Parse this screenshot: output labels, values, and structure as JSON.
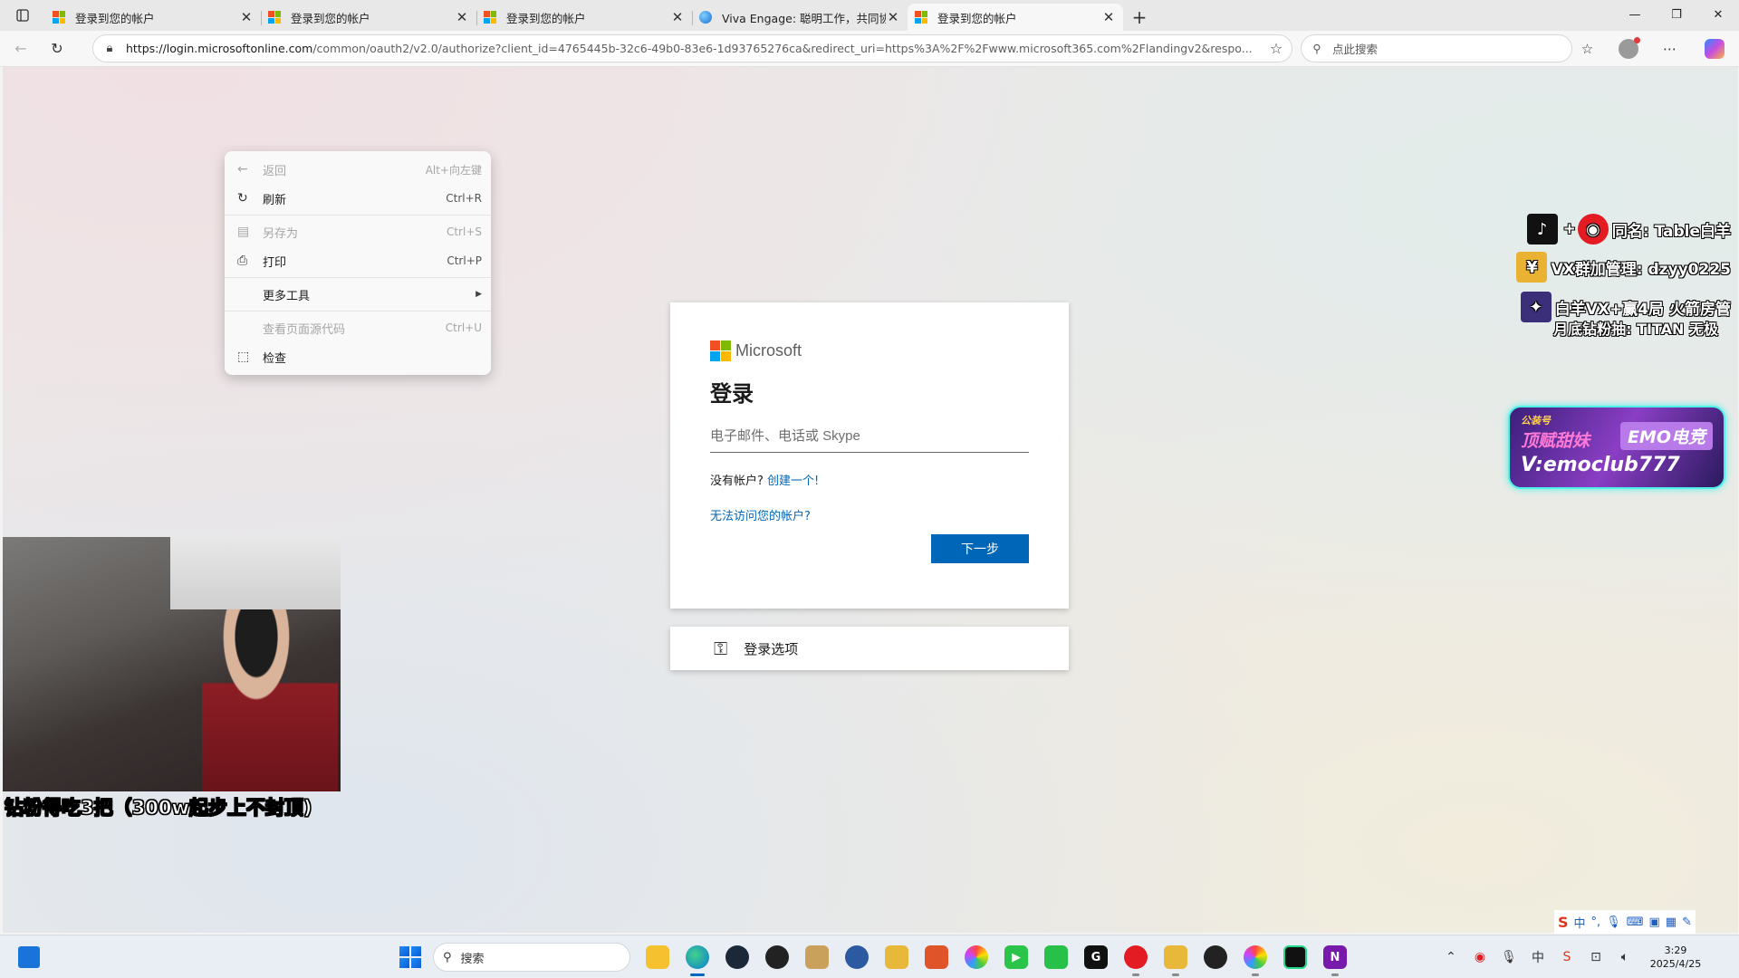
{
  "browser": {
    "tabs": [
      {
        "title": "登录到您的帐户",
        "favicon": "microsoft-icon",
        "active": false
      },
      {
        "title": "登录到您的帐户",
        "favicon": "microsoft-icon",
        "active": false
      },
      {
        "title": "登录到您的帐户",
        "favicon": "microsoft-icon",
        "active": false
      },
      {
        "title": "Viva Engage: 聪明工作，共同协作",
        "favicon": "viva-engage-icon",
        "active": false
      },
      {
        "title": "登录到您的帐户",
        "favicon": "microsoft-icon",
        "active": true
      }
    ],
    "url_host": "https://login.microsoftonline.com",
    "url_rest": "/common/oauth2/v2.0/authorize?client_id=4765445b-32c6-49b0-83e6-1d93765276ca&redirect_uri=https%3A%2F%2Fwww.microsoft365.com%2Flandingv2&respo...",
    "search_placeholder": "点此搜索"
  },
  "context_menu": {
    "items": [
      {
        "label": "返回",
        "shortcut": "Alt+向左键",
        "icon": "back-arrow-icon",
        "disabled": true
      },
      {
        "label": "刷新",
        "shortcut": "Ctrl+R",
        "icon": "refresh-icon",
        "disabled": false
      },
      {
        "label": "另存为",
        "shortcut": "Ctrl+S",
        "icon": "save-as-icon",
        "disabled": true
      },
      {
        "label": "打印",
        "shortcut": "Ctrl+P",
        "icon": "printer-icon",
        "disabled": false
      },
      {
        "label": "更多工具",
        "shortcut": "",
        "icon": "",
        "disabled": false
      },
      {
        "label": "查看页面源代码",
        "shortcut": "Ctrl+U",
        "icon": "",
        "disabled": true
      },
      {
        "label": "检查",
        "shortcut": "",
        "icon": "inspect-icon",
        "disabled": false
      }
    ]
  },
  "login": {
    "brand": "Microsoft",
    "heading": "登录",
    "email_placeholder": "电子邮件、电话或 Skype",
    "no_account_text": "没有帐户?",
    "create_link": "创建一个!",
    "cant_access_link": "无法访问您的帐户?",
    "next_button": "下一步",
    "options_label": "登录选项"
  },
  "stream": {
    "cam_caption": "钻粉得吃3把（300w起步上不封顶)",
    "overlay_line1": "同名: Table白羊",
    "overlay_line2": "VX群加管理: dzyy0225",
    "overlay_line3a": "白羊VX+赢4局 火箭房管",
    "overlay_line3b": "月底钻粉抽: TITAN 无极",
    "emo_small": "公装号",
    "emo_pink": "顶赋甜妹",
    "emo_badge": "EMO电竞",
    "emo_handle": "V:emoclub777"
  },
  "ime": {
    "mode": "中"
  },
  "taskbar": {
    "search_label": "搜索",
    "time": "3:29",
    "date": "2025/4/25"
  }
}
